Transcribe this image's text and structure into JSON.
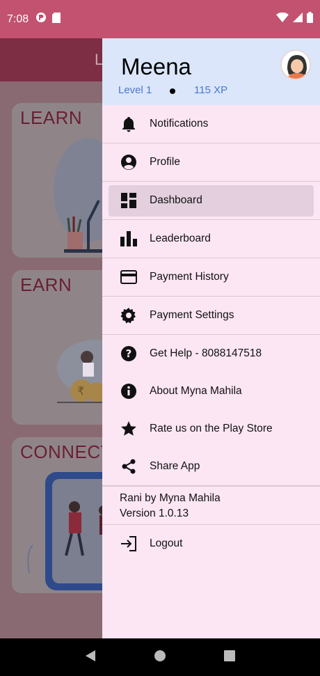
{
  "status_bar": {
    "time": "7:08"
  },
  "background": {
    "app_title_fragment": "L",
    "cards": [
      {
        "title": "LEARN"
      },
      {
        "title": "EARN"
      },
      {
        "title": "CONNECT"
      }
    ]
  },
  "drawer": {
    "user_name": "Meena",
    "level": "Level 1",
    "xp": "115 XP",
    "items": [
      {
        "label": "Notifications",
        "icon": "bell-icon"
      },
      {
        "label": "Profile",
        "icon": "account-circle-icon"
      },
      {
        "label": "Dashboard",
        "icon": "dashboard-icon",
        "selected": true
      },
      {
        "label": "Leaderboard",
        "icon": "bar-chart-icon"
      },
      {
        "label": "Payment History",
        "icon": "credit-card-icon"
      },
      {
        "label": "Payment Settings",
        "icon": "gear-icon"
      },
      {
        "label": "Get Help - 8088147518",
        "icon": "help-icon"
      },
      {
        "label": "About Myna Mahila",
        "icon": "info-icon"
      },
      {
        "label": "Rate us on the Play Store",
        "icon": "star-icon"
      },
      {
        "label": "Share App",
        "icon": "share-icon"
      }
    ],
    "app_name": "Rani by Myna Mahila",
    "version": "Version 1.0.13",
    "logout_label": "Logout"
  },
  "colors": {
    "status_bar": "#c2526f",
    "drawer_bg": "#fde6f4",
    "header_bg": "#dbe6fb",
    "accent_text": "#4a77d0",
    "selected_bg": "#e3cfde"
  }
}
